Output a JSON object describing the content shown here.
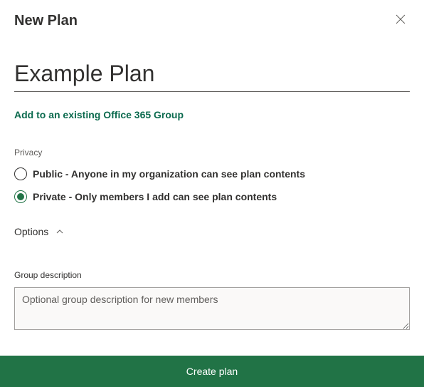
{
  "header": {
    "title": "New Plan"
  },
  "plan_name": {
    "value": "Example Plan"
  },
  "links": {
    "add_existing": "Add to an existing Office 365 Group"
  },
  "privacy": {
    "label": "Privacy",
    "options": {
      "public": "Public - Anyone in my organization can see plan contents",
      "private": "Private - Only members I add can see plan contents"
    },
    "selected": "private"
  },
  "options_toggle": {
    "label": "Options"
  },
  "group_description": {
    "label": "Group description",
    "placeholder": "Optional group description for new members",
    "value": ""
  },
  "footer": {
    "create_label": "Create plan"
  }
}
